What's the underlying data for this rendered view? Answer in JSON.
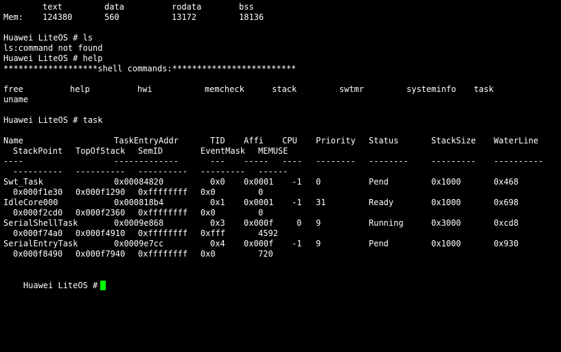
{
  "terminal": {
    "mem_table": {
      "headers": [
        "text",
        "data",
        "rodata",
        "bss"
      ],
      "row_label": "Mem:",
      "values": [
        "124380",
        "560",
        "13172",
        "18136"
      ]
    },
    "prompt1": "Huawei LiteOS # ls",
    "error_line": "ls:command not found",
    "prompt2": "Huawei LiteOS # help",
    "shell_banner": "*******************shell commands:*************************",
    "commands": [
      "free",
      "help",
      "hwi",
      "memcheck",
      "stack",
      "swtmr",
      "systeminfo",
      "task",
      "uname"
    ],
    "prompt3": "Huawei LiteOS # task",
    "task_table": {
      "headers1": [
        "Name",
        "TaskEntryAddr",
        "TID",
        "Affi",
        "CPU",
        "Priority",
        "Status",
        "StackSize",
        "WaterLine"
      ],
      "headers2": [
        "StackPoint",
        "TopOfStack",
        "SemID",
        "EventMask",
        "MEMUSE"
      ],
      "dash1": [
        "----",
        "-------------",
        "---",
        "-----",
        "----",
        "--------",
        "--------",
        "---------",
        "----------"
      ],
      "dash2": [
        "----------",
        "----------",
        "----------",
        "---------",
        "------"
      ],
      "rows": [
        {
          "name": "Swt_Task",
          "entry": "0x00084820",
          "tid": "0x0",
          "affi": "0x0001",
          "cpu": "-1",
          "priority": "0",
          "status": "Pend",
          "stacksize": "0x1000",
          "waterline": "0x468",
          "stackpoint": "0x000f1e30",
          "topofstack": "0x000f1290",
          "semid": "0xffffffff",
          "eventmask": "0x0",
          "memuse": "0"
        },
        {
          "name": "IdleCore000",
          "entry": "0x000818b4",
          "tid": "0x1",
          "affi": "0x0001",
          "cpu": "-1",
          "priority": "31",
          "status": "Ready",
          "stacksize": "0x1000",
          "waterline": "0x698",
          "stackpoint": "0x000f2cd0",
          "topofstack": "0x000f2360",
          "semid": "0xffffffff",
          "eventmask": "0x0",
          "memuse": "0"
        },
        {
          "name": "SerialShellTask",
          "entry": "0x0009e868",
          "tid": "0x3",
          "affi": "0x000f",
          "cpu": "0",
          "priority": "9",
          "status": "Running",
          "stacksize": "0x3000",
          "waterline": "0xcd8",
          "stackpoint": "0x000f74a0",
          "topofstack": "0x000f4910",
          "semid": "0xffffffff",
          "eventmask": "0xfff",
          "memuse": "4592"
        },
        {
          "name": "SerialEntryTask",
          "entry": "0x0009e7cc",
          "tid": "0x4",
          "affi": "0x000f",
          "cpu": "-1",
          "priority": "9",
          "status": "Pend",
          "stacksize": "0x1000",
          "waterline": "0x930",
          "stackpoint": "0x000f8490",
          "topofstack": "0x000f7940",
          "semid": "0xffffffff",
          "eventmask": "0x0",
          "memuse": "720"
        }
      ]
    },
    "final_prompt": "Huawei LiteOS #",
    "colors": {
      "background": "#000000",
      "text": "#ffffff",
      "cursor": "#00ff00"
    }
  }
}
